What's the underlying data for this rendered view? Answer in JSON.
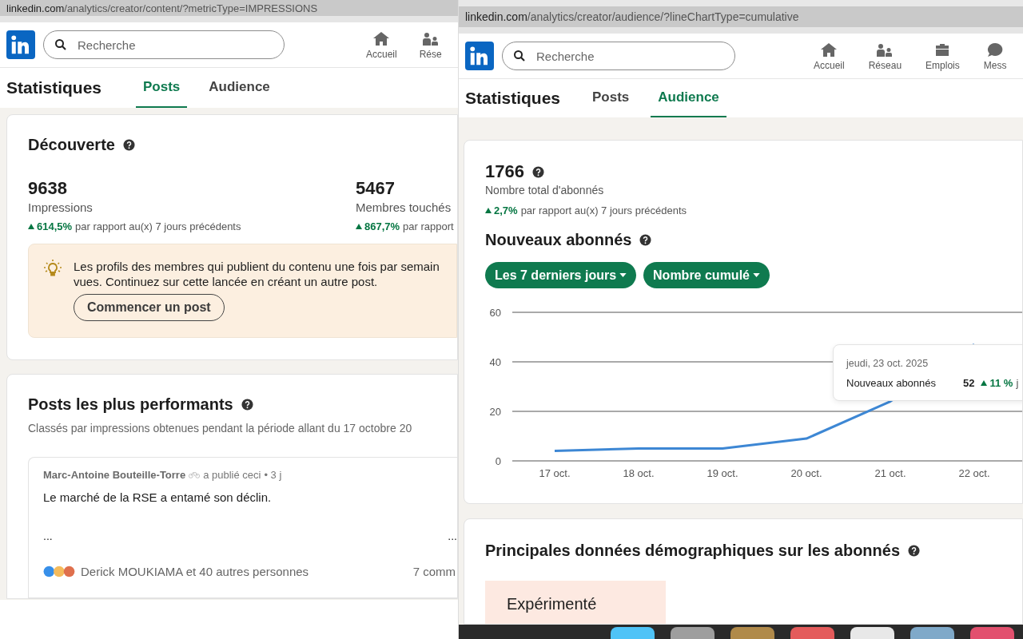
{
  "left": {
    "url": {
      "host": "linkedin.com",
      "path": "/analytics/creator/content/?metricType=IMPRESSIONS"
    },
    "nav": {
      "search_placeholder": "Recherche",
      "items": [
        {
          "label": "Accueil",
          "kind": "home"
        },
        {
          "label": "Rése",
          "kind": "network"
        }
      ]
    },
    "header": {
      "title": "Statistiques",
      "tabs": [
        {
          "label": "Posts",
          "selected": true
        },
        {
          "label": "Audience",
          "selected": false
        }
      ]
    },
    "discovery": {
      "title": "Découverte",
      "metrics": [
        {
          "value": "9638",
          "label": "Impressions",
          "change": "614,5%",
          "note": "par rapport au(x) 7 jours précédents"
        },
        {
          "value": "5467",
          "label": "Membres touchés",
          "change": "867,7%",
          "note": "par rapport"
        }
      ],
      "tip": {
        "lines": [
          "Les profils des membres qui publient du contenu une fois par semain",
          "vues. Continuez sur cette lancée en créant un autre post."
        ],
        "button": "Commencer un post"
      }
    },
    "top_posts": {
      "title": "Posts les plus performants",
      "subtitle": "Classés par impressions obtenues pendant la période allant du 17 octobre 20",
      "post": {
        "author": "Marc-Antoine Bouteille-Torre",
        "action": "a publié ceci",
        "age": "• 3 j",
        "text": "Le marché de la RSE a entamé son déclin.",
        "more_left": "...",
        "more_right": "...",
        "reactions": "Derick MOUKIAMA et 40 autres personnes",
        "comments": "7 comm"
      }
    }
  },
  "right": {
    "url": {
      "host": "linkedin.com",
      "path": "/analytics/creator/audience/?lineChartType=cumulative"
    },
    "nav": {
      "search_placeholder": "Recherche",
      "items": [
        {
          "label": "Accueil",
          "kind": "home"
        },
        {
          "label": "Réseau",
          "kind": "network"
        },
        {
          "label": "Emplois",
          "kind": "jobs"
        },
        {
          "label": "Mess",
          "kind": "messages"
        }
      ]
    },
    "header": {
      "title": "Statistiques",
      "tabs": [
        {
          "label": "Posts",
          "selected": false
        },
        {
          "label": "Audience",
          "selected": true
        }
      ]
    },
    "followers": {
      "total": "1766",
      "total_label": "Nombre total d'abonnés",
      "change": "2,7%",
      "note": "par rapport au(x) 7 jours précédents",
      "title": "Nouveaux abonnés",
      "filters": [
        "Les 7 derniers jours",
        "Nombre cumulé"
      ],
      "chart_data": {
        "type": "line",
        "categories": [
          "17 oct.",
          "18 oct.",
          "19 oct.",
          "20 oct.",
          "21 oct.",
          "22 oct."
        ],
        "series": [
          {
            "name": "Nouveaux abonnés",
            "color": "#3d87d4",
            "values": [
              4,
              5,
              5,
              9,
              24,
              47
            ]
          }
        ],
        "ylim": [
          0,
          60
        ],
        "yticks": [
          0,
          20,
          40,
          60
        ]
      },
      "tooltip": {
        "date": "jeudi, 23 oct. 2025",
        "value": "52",
        "change": "11 %",
        "suffix": "j"
      }
    },
    "demographics": {
      "title": "Principales données démographiques sur les abonnés",
      "first": "Expérimenté"
    }
  }
}
